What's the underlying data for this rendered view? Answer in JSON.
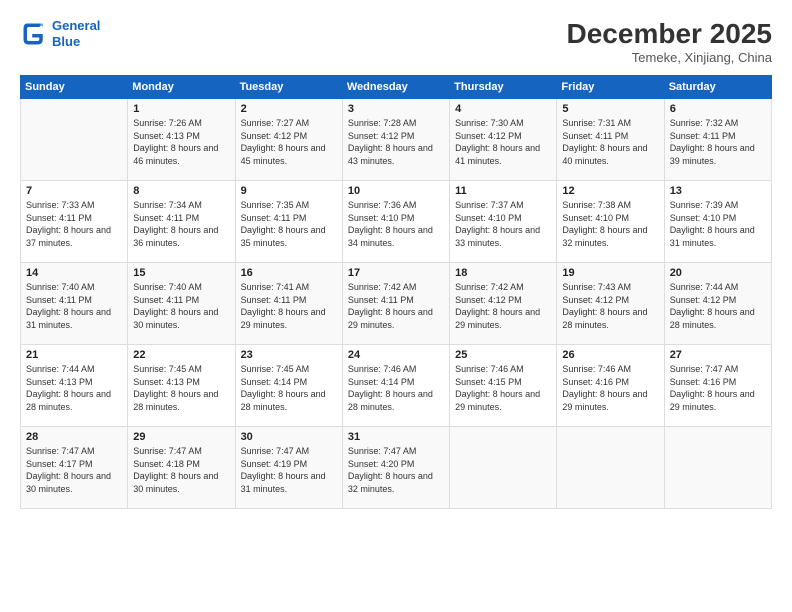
{
  "header": {
    "logo_line1": "General",
    "logo_line2": "Blue",
    "month": "December 2025",
    "location": "Temeke, Xinjiang, China"
  },
  "weekdays": [
    "Sunday",
    "Monday",
    "Tuesday",
    "Wednesday",
    "Thursday",
    "Friday",
    "Saturday"
  ],
  "weeks": [
    [
      {
        "day": "",
        "sunrise": "",
        "sunset": "",
        "daylight": ""
      },
      {
        "day": "1",
        "sunrise": "7:26 AM",
        "sunset": "4:13 PM",
        "daylight": "8 hours and 46 minutes."
      },
      {
        "day": "2",
        "sunrise": "7:27 AM",
        "sunset": "4:12 PM",
        "daylight": "8 hours and 45 minutes."
      },
      {
        "day": "3",
        "sunrise": "7:28 AM",
        "sunset": "4:12 PM",
        "daylight": "8 hours and 43 minutes."
      },
      {
        "day": "4",
        "sunrise": "7:30 AM",
        "sunset": "4:12 PM",
        "daylight": "8 hours and 41 minutes."
      },
      {
        "day": "5",
        "sunrise": "7:31 AM",
        "sunset": "4:11 PM",
        "daylight": "8 hours and 40 minutes."
      },
      {
        "day": "6",
        "sunrise": "7:32 AM",
        "sunset": "4:11 PM",
        "daylight": "8 hours and 39 minutes."
      }
    ],
    [
      {
        "day": "7",
        "sunrise": "7:33 AM",
        "sunset": "4:11 PM",
        "daylight": "8 hours and 37 minutes."
      },
      {
        "day": "8",
        "sunrise": "7:34 AM",
        "sunset": "4:11 PM",
        "daylight": "8 hours and 36 minutes."
      },
      {
        "day": "9",
        "sunrise": "7:35 AM",
        "sunset": "4:11 PM",
        "daylight": "8 hours and 35 minutes."
      },
      {
        "day": "10",
        "sunrise": "7:36 AM",
        "sunset": "4:10 PM",
        "daylight": "8 hours and 34 minutes."
      },
      {
        "day": "11",
        "sunrise": "7:37 AM",
        "sunset": "4:10 PM",
        "daylight": "8 hours and 33 minutes."
      },
      {
        "day": "12",
        "sunrise": "7:38 AM",
        "sunset": "4:10 PM",
        "daylight": "8 hours and 32 minutes."
      },
      {
        "day": "13",
        "sunrise": "7:39 AM",
        "sunset": "4:10 PM",
        "daylight": "8 hours and 31 minutes."
      }
    ],
    [
      {
        "day": "14",
        "sunrise": "7:40 AM",
        "sunset": "4:11 PM",
        "daylight": "8 hours and 31 minutes."
      },
      {
        "day": "15",
        "sunrise": "7:40 AM",
        "sunset": "4:11 PM",
        "daylight": "8 hours and 30 minutes."
      },
      {
        "day": "16",
        "sunrise": "7:41 AM",
        "sunset": "4:11 PM",
        "daylight": "8 hours and 29 minutes."
      },
      {
        "day": "17",
        "sunrise": "7:42 AM",
        "sunset": "4:11 PM",
        "daylight": "8 hours and 29 minutes."
      },
      {
        "day": "18",
        "sunrise": "7:42 AM",
        "sunset": "4:12 PM",
        "daylight": "8 hours and 29 minutes."
      },
      {
        "day": "19",
        "sunrise": "7:43 AM",
        "sunset": "4:12 PM",
        "daylight": "8 hours and 28 minutes."
      },
      {
        "day": "20",
        "sunrise": "7:44 AM",
        "sunset": "4:12 PM",
        "daylight": "8 hours and 28 minutes."
      }
    ],
    [
      {
        "day": "21",
        "sunrise": "7:44 AM",
        "sunset": "4:13 PM",
        "daylight": "8 hours and 28 minutes."
      },
      {
        "day": "22",
        "sunrise": "7:45 AM",
        "sunset": "4:13 PM",
        "daylight": "8 hours and 28 minutes."
      },
      {
        "day": "23",
        "sunrise": "7:45 AM",
        "sunset": "4:14 PM",
        "daylight": "8 hours and 28 minutes."
      },
      {
        "day": "24",
        "sunrise": "7:46 AM",
        "sunset": "4:14 PM",
        "daylight": "8 hours and 28 minutes."
      },
      {
        "day": "25",
        "sunrise": "7:46 AM",
        "sunset": "4:15 PM",
        "daylight": "8 hours and 29 minutes."
      },
      {
        "day": "26",
        "sunrise": "7:46 AM",
        "sunset": "4:16 PM",
        "daylight": "8 hours and 29 minutes."
      },
      {
        "day": "27",
        "sunrise": "7:47 AM",
        "sunset": "4:16 PM",
        "daylight": "8 hours and 29 minutes."
      }
    ],
    [
      {
        "day": "28",
        "sunrise": "7:47 AM",
        "sunset": "4:17 PM",
        "daylight": "8 hours and 30 minutes."
      },
      {
        "day": "29",
        "sunrise": "7:47 AM",
        "sunset": "4:18 PM",
        "daylight": "8 hours and 30 minutes."
      },
      {
        "day": "30",
        "sunrise": "7:47 AM",
        "sunset": "4:19 PM",
        "daylight": "8 hours and 31 minutes."
      },
      {
        "day": "31",
        "sunrise": "7:47 AM",
        "sunset": "4:20 PM",
        "daylight": "8 hours and 32 minutes."
      },
      {
        "day": "",
        "sunrise": "",
        "sunset": "",
        "daylight": ""
      },
      {
        "day": "",
        "sunrise": "",
        "sunset": "",
        "daylight": ""
      },
      {
        "day": "",
        "sunrise": "",
        "sunset": "",
        "daylight": ""
      }
    ]
  ]
}
